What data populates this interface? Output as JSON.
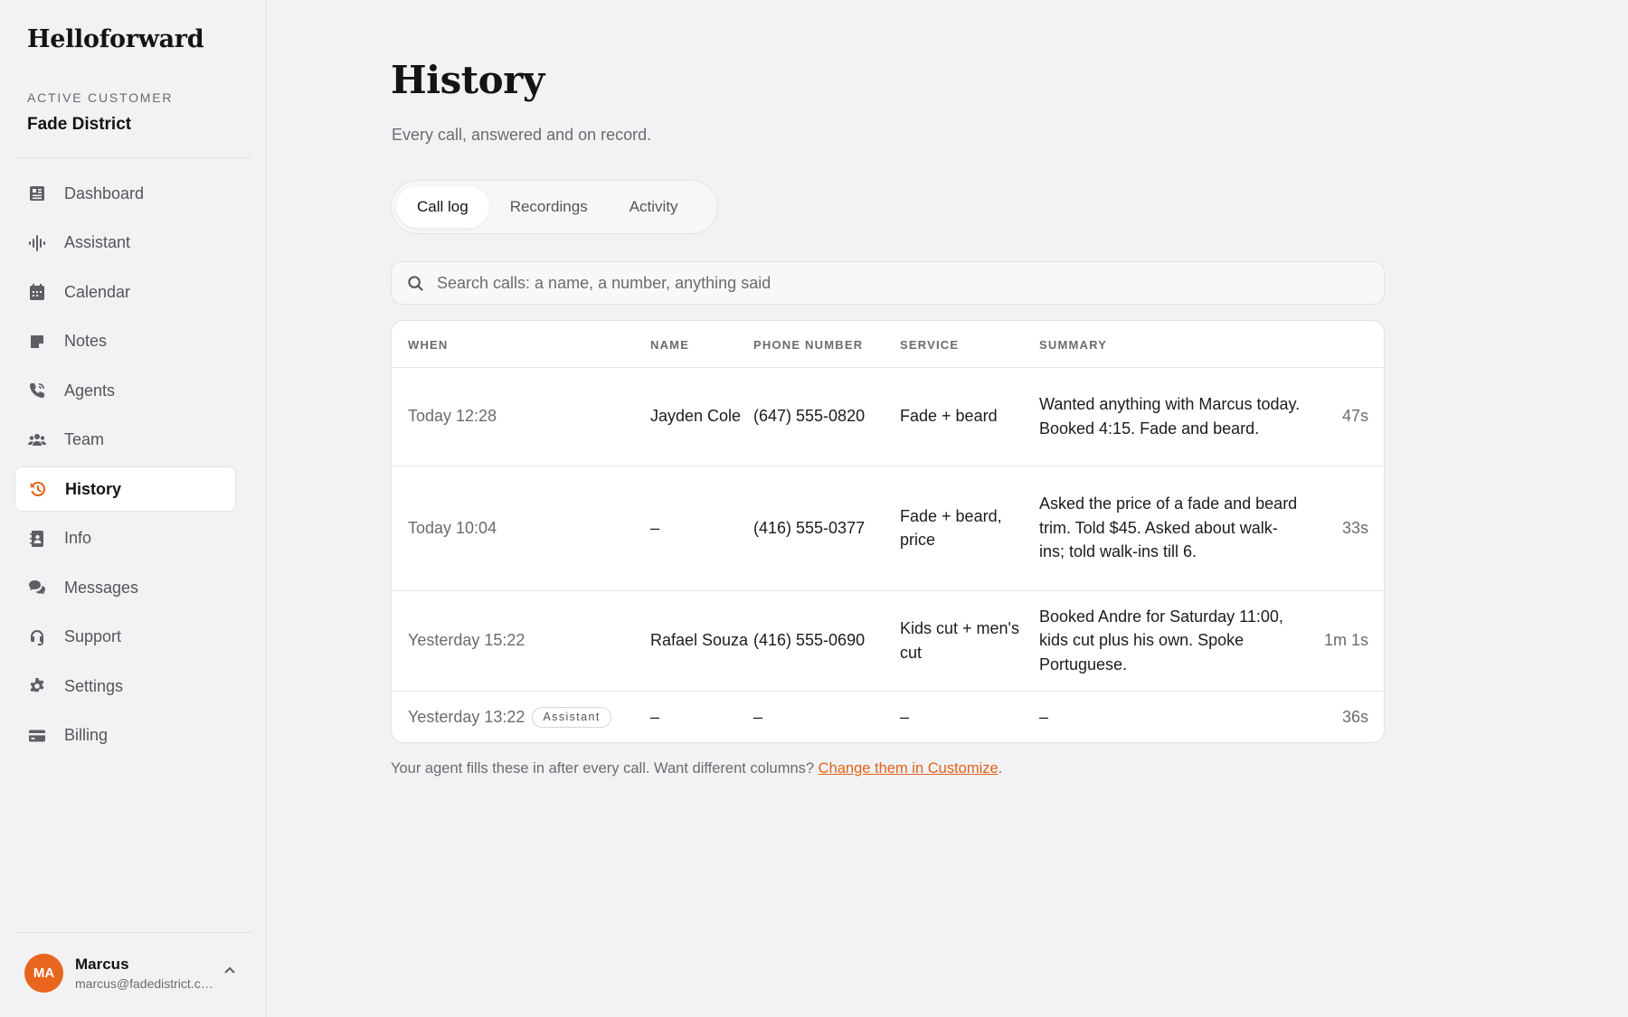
{
  "brand": "Helloforward",
  "customer": {
    "label": "Active Customer",
    "name": "Fade District"
  },
  "nav": [
    {
      "label": "Dashboard",
      "icon": "dashboard-icon"
    },
    {
      "label": "Assistant",
      "icon": "waveform-icon"
    },
    {
      "label": "Calendar",
      "icon": "calendar-icon"
    },
    {
      "label": "Notes",
      "icon": "note-icon"
    },
    {
      "label": "Agents",
      "icon": "phone-icon"
    },
    {
      "label": "Team",
      "icon": "users-icon"
    },
    {
      "label": "History",
      "icon": "history-icon",
      "active": true
    },
    {
      "label": "Info",
      "icon": "contact-card-icon"
    },
    {
      "label": "Messages",
      "icon": "chat-icon"
    },
    {
      "label": "Support",
      "icon": "headset-icon"
    },
    {
      "label": "Settings",
      "icon": "gear-icon"
    },
    {
      "label": "Billing",
      "icon": "credit-card-icon"
    }
  ],
  "user": {
    "initials": "MA",
    "name": "Marcus",
    "email": "marcus@fadedistrict.com"
  },
  "page": {
    "title": "History",
    "subtitle": "Every call, answered and on record."
  },
  "tabs": [
    {
      "label": "Call log",
      "active": true
    },
    {
      "label": "Recordings"
    },
    {
      "label": "Activity"
    }
  ],
  "search": {
    "placeholder": "Search calls: a name, a number, anything said",
    "value": ""
  },
  "table": {
    "headers": [
      "When",
      "Name",
      "Phone Number",
      "Service",
      "Summary",
      ""
    ],
    "rows": [
      {
        "when": "Today 12:28",
        "name": "Jayden Cole",
        "phone": "(647) 555-0820",
        "service": "Fade + beard",
        "summary": "Wanted anything with Marcus today. Booked 4:15. Fade and beard.",
        "duration": "47s"
      },
      {
        "when": "Today 10:04",
        "name": "–",
        "phone": "(416) 555-0377",
        "service": "Fade + beard, price",
        "summary": "Asked the price of a fade and beard trim. Told $45. Asked about walk-ins; told walk-ins till 6.",
        "duration": "33s"
      },
      {
        "when": "Yesterday 15:22",
        "name": "Rafael Souza",
        "phone": "(416) 555-0690",
        "service": "Kids cut + men's cut",
        "summary": "Booked Andre for Saturday 11:00, kids cut plus his own. Spoke Portuguese.",
        "duration": "1m 1s"
      },
      {
        "when": "Yesterday 13:22",
        "badge": "Assistant",
        "name": "–",
        "phone": "–",
        "service": "–",
        "summary": "–",
        "duration": "36s"
      }
    ]
  },
  "footnote": {
    "text": "Your agent fills these in after every call. Want different columns?",
    "link": "Change them in Customize",
    "end": "."
  },
  "colors": {
    "accent": "#e0621b",
    "avatar": "#e8651e",
    "background": "#f2f2f4"
  }
}
